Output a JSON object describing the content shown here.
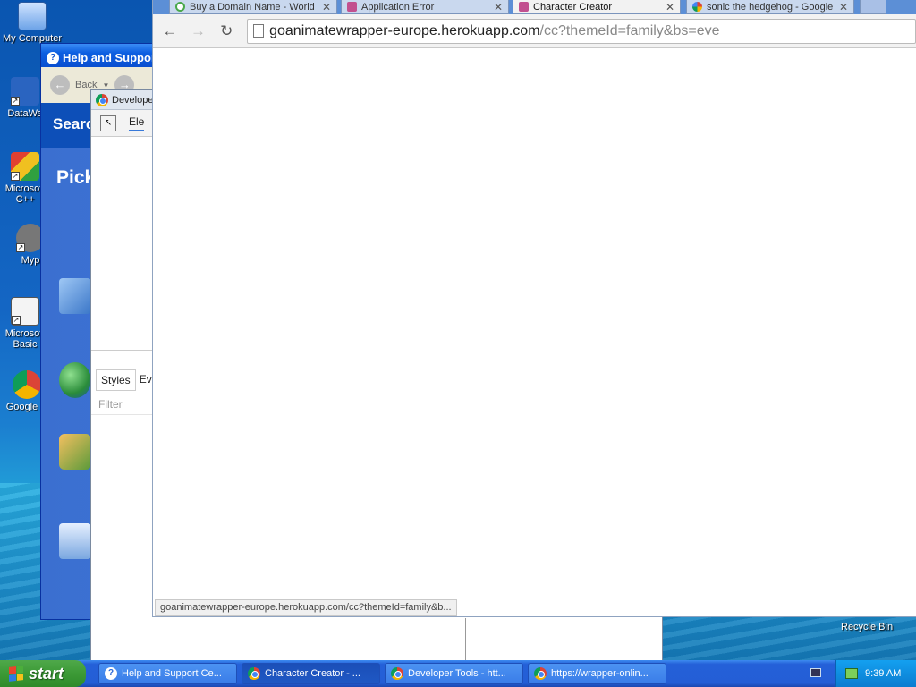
{
  "desktop": {
    "icons": [
      {
        "label": "My Computer"
      },
      {
        "label": "DataWa"
      },
      {
        "label": "Microsoft C++"
      },
      {
        "label": "Myp"
      },
      {
        "label": "Microsoft Basic"
      },
      {
        "label": "Google C"
      }
    ],
    "recycle_bin": "Recycle Bin"
  },
  "help_window": {
    "title": "Help and Suppor",
    "back_label": "Back",
    "search_label": "Searc",
    "pick_label": "Pick"
  },
  "devtools_window": {
    "title": "Develope",
    "elements_tab": "Ele",
    "styles_tab": "Styles",
    "event_tab": "Eve",
    "filter_placeholder": "Filter"
  },
  "browser": {
    "tabs": [
      {
        "title": "Buy a Domain Name - World",
        "icon": "domain-icon",
        "color": "#4aa84a"
      },
      {
        "title": "Application Error",
        "icon": "puzzle-icon",
        "color": "#c2508f"
      },
      {
        "title": "Character Creator",
        "icon": "puzzle-icon",
        "color": "#c2508f"
      },
      {
        "title": "sonic the hedgehog - Google",
        "icon": "google-icon",
        "color": "#4285f4"
      }
    ],
    "url_host": "goanimatewrapper-europe.herokuapp.com",
    "url_rest": "/cc?themeId=family&bs=eve",
    "status_url": "goanimatewrapper-europe.herokuapp.com/cc?themeId=family&b..."
  },
  "taskbar": {
    "start_label": "start",
    "buttons": [
      {
        "label": "Help and Support Ce..."
      },
      {
        "label": "Character Creator - ..."
      },
      {
        "label": "Developer Tools - htt..."
      },
      {
        "label": "https://wrapper-onlin..."
      }
    ],
    "clock": "9:39 AM"
  }
}
